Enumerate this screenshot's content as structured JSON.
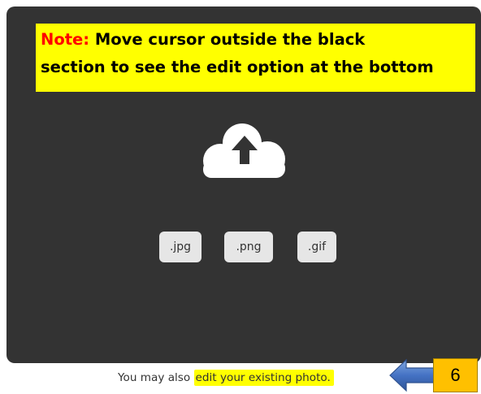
{
  "note": {
    "label": "Note:",
    "line1": "Move cursor outside the black",
    "line2": "section to see the edit option at the bottom"
  },
  "upload": {
    "icon": "cloud-upload-icon",
    "formats": [
      ".jpg",
      ".png",
      ".gif"
    ]
  },
  "footer": {
    "prefix": "You may also",
    "link": "edit your existing photo",
    "suffix": "."
  },
  "callout": {
    "arrow_icon": "left-arrow-icon",
    "step": "6"
  },
  "colors": {
    "dropzone_bg": "#333333",
    "highlight": "#ffff00",
    "note_label": "#ff0000",
    "badge_bg": "#e6e6e6",
    "arrow": "#4472c4",
    "step_badge": "#ffc000"
  }
}
